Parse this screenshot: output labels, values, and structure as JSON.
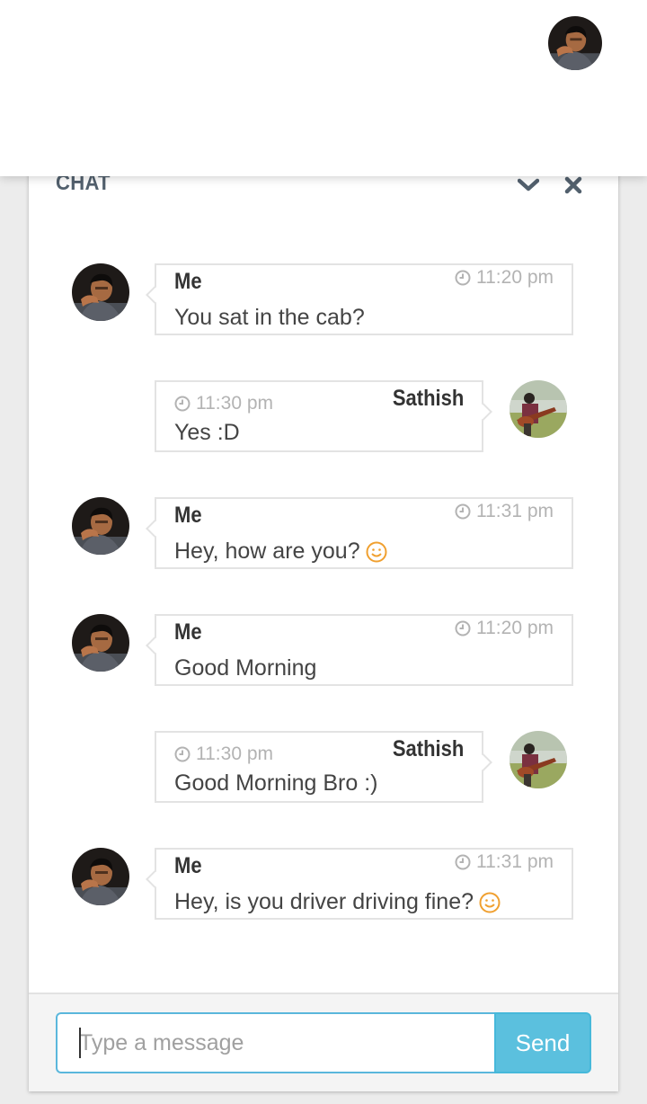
{
  "header": {
    "title": "CHAT"
  },
  "messages": [
    {
      "side": "left",
      "sender": "Me",
      "time": "11:20 pm",
      "text": "You sat in the cab?",
      "emoji": false,
      "avatar": "me-avatar"
    },
    {
      "side": "right",
      "sender": "Sathish",
      "time": "11:30 pm",
      "text": "Yes :D",
      "emoji": false,
      "avatar": "sathish-avatar"
    },
    {
      "side": "left",
      "sender": "Me",
      "time": "11:31 pm",
      "text": "Hey, how are you?",
      "emoji": true,
      "avatar": "me-avatar"
    },
    {
      "side": "left",
      "sender": "Me",
      "time": "11:20 pm",
      "text": "Good Morning",
      "emoji": false,
      "avatar": "me-avatar"
    },
    {
      "side": "right",
      "sender": "Sathish",
      "time": "11:30 pm",
      "text": "Good Morning Bro :)",
      "emoji": false,
      "avatar": "sathish-avatar"
    },
    {
      "side": "left",
      "sender": "Me",
      "time": "11:31 pm",
      "text": "Hey, is you driver driving fine?",
      "emoji": true,
      "avatar": "me-avatar"
    }
  ],
  "composer": {
    "placeholder": "Type a message",
    "send_label": "Send"
  },
  "icons": {
    "collapse": "chevron-down-icon",
    "close": "close-icon",
    "time": "clock-icon",
    "emoji": "smiley-icon"
  },
  "colors": {
    "accent": "#5bc0de",
    "emoji": "#f0a030",
    "text": "#444444",
    "muted": "#b3b3b3"
  }
}
